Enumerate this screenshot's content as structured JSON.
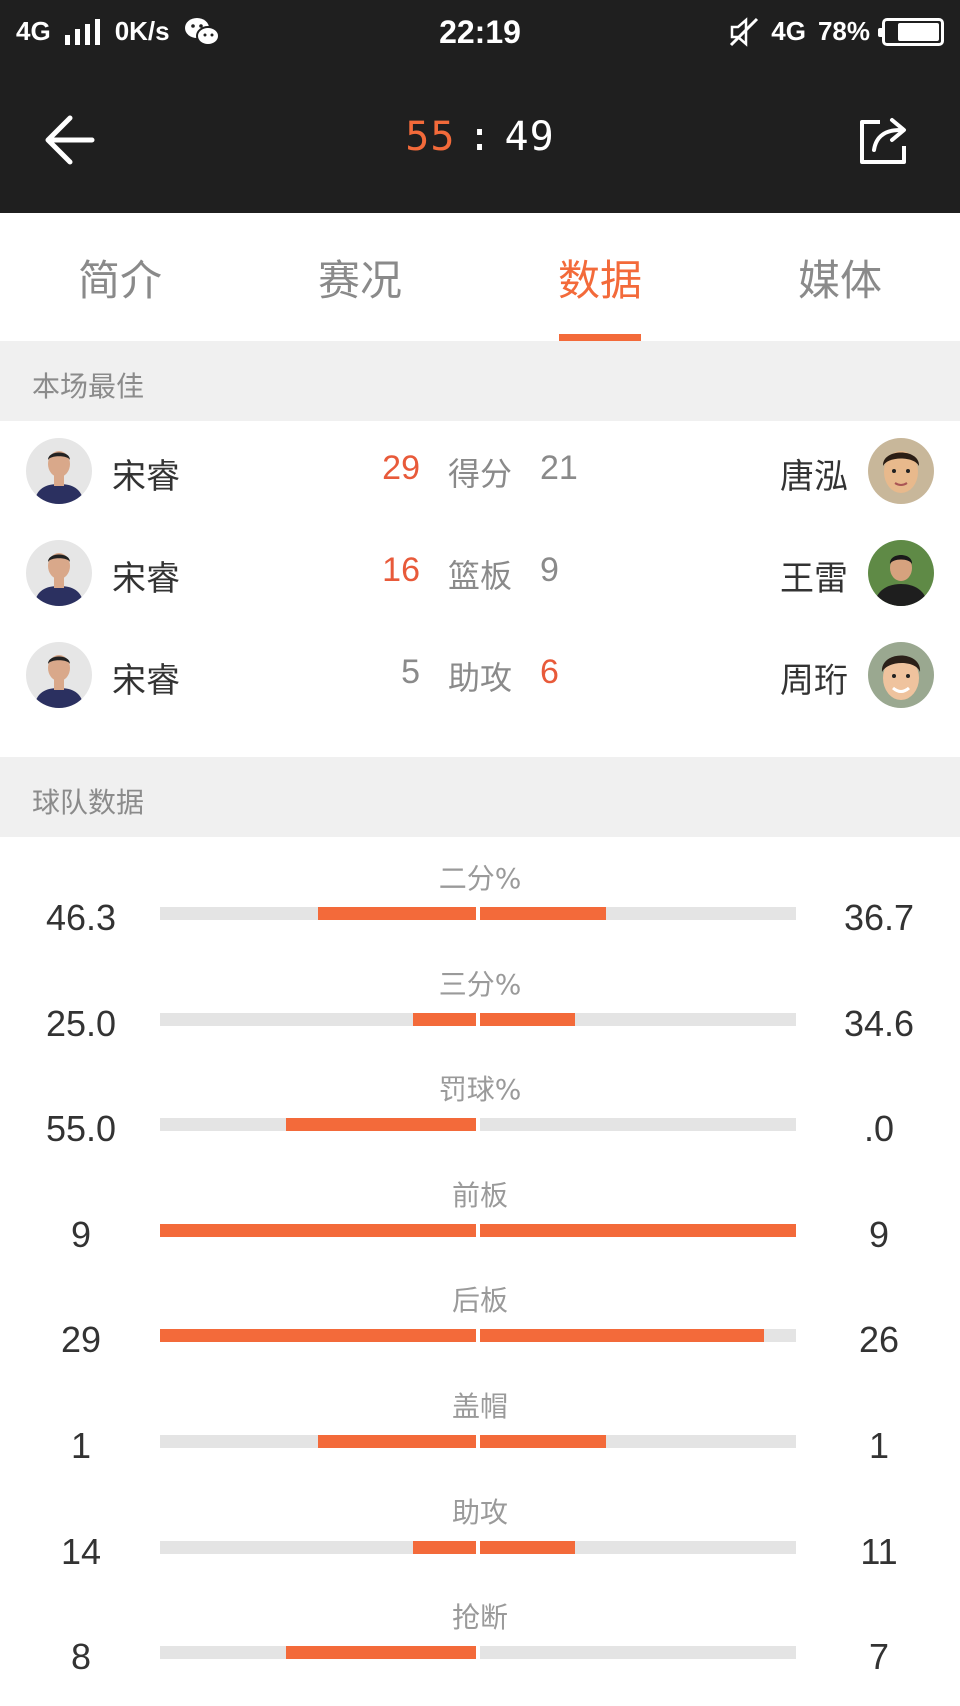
{
  "status_bar": {
    "network": "4G",
    "speed": "0K/s",
    "time": "22:19",
    "network_right": "4G",
    "battery": "78%",
    "battery_level": 0.78
  },
  "header": {
    "home_score": "55",
    "separator": ":",
    "away_score": "49"
  },
  "tabs": [
    {
      "label": "简介",
      "active": false
    },
    {
      "label": "赛况",
      "active": false
    },
    {
      "label": "数据",
      "active": true
    },
    {
      "label": "媒体",
      "active": false
    }
  ],
  "best": {
    "title": "本场最佳",
    "rows": [
      {
        "left_name": "宋睿",
        "left_value": "29",
        "left_highlight": true,
        "category": "得分",
        "right_value": "21",
        "right_highlight": false,
        "right_name": "唐泓"
      },
      {
        "left_name": "宋睿",
        "left_value": "16",
        "left_highlight": true,
        "category": "篮板",
        "right_value": "9",
        "right_highlight": false,
        "right_name": "王雷"
      },
      {
        "left_name": "宋睿",
        "left_value": "5",
        "left_highlight": false,
        "category": "助攻",
        "right_value": "6",
        "right_highlight": true,
        "right_name": "周珩"
      }
    ]
  },
  "team": {
    "title": "球队数据",
    "stats": [
      {
        "label": "二分%",
        "left": "46.3",
        "right": "36.7",
        "left_fill": 0.5,
        "right_fill": 0.4
      },
      {
        "label": "三分%",
        "left": "25.0",
        "right": "34.6",
        "left_fill": 0.2,
        "right_fill": 0.3
      },
      {
        "label": "罚球%",
        "left": "55.0",
        "right": ".0",
        "left_fill": 0.6,
        "right_fill": 0.0
      },
      {
        "label": "前板",
        "left": "9",
        "right": "9",
        "left_fill": 1.0,
        "right_fill": 1.0
      },
      {
        "label": "后板",
        "left": "29",
        "right": "26",
        "left_fill": 1.0,
        "right_fill": 0.9
      },
      {
        "label": "盖帽",
        "left": "1",
        "right": "1",
        "left_fill": 0.5,
        "right_fill": 0.4
      },
      {
        "label": "助攻",
        "left": "14",
        "right": "11",
        "left_fill": 0.2,
        "right_fill": 0.3
      },
      {
        "label": "抢断",
        "left": "8",
        "right": "7",
        "left_fill": 0.6,
        "right_fill": 0.0
      }
    ]
  }
}
